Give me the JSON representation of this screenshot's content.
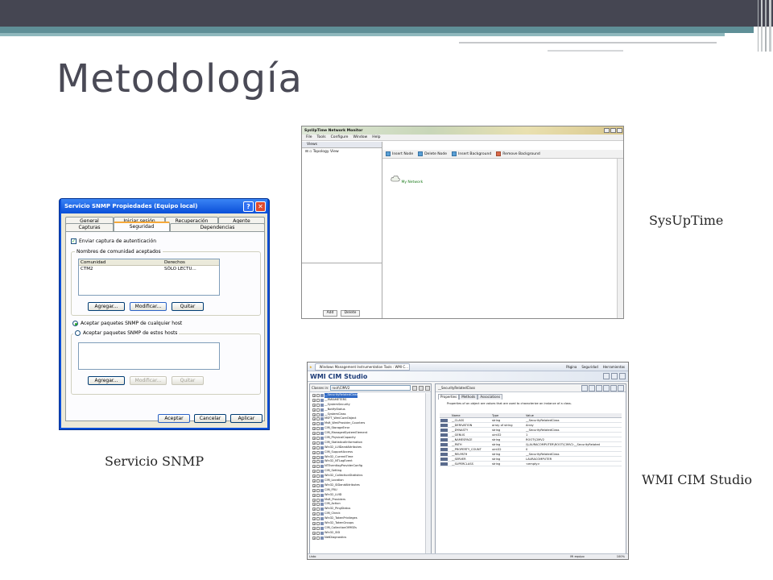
{
  "slide": {
    "title": "Metodología",
    "captions": {
      "sysuptime": "SysUpTime",
      "snmp": "Servicio SNMP",
      "wmi": "WMI CIM Studio"
    }
  },
  "snmp_dialog": {
    "title": "Servicio SNMP Propiedades (Equipo local)",
    "help_glyph": "?",
    "close_glyph": "✕",
    "tabs_row1": [
      "General",
      "Iniciar sesión",
      "Recuperación",
      "Agente"
    ],
    "tabs_row2": [
      "Capturas",
      "Seguridad",
      "Dependencias"
    ],
    "active_tab": "Seguridad",
    "send_auth_trap": "Enviar captura de autenticación",
    "communities_group": "Nombres de comunidad aceptados",
    "list_headers": [
      "Comunidad",
      "Derechos"
    ],
    "list_rows": [
      [
        "CTM2",
        "SÓLO LECTU..."
      ]
    ],
    "community_buttons": [
      "Agregar...",
      "Modificar...",
      "Quitar"
    ],
    "radio_any_host": "Aceptar paquetes SNMP de cualquier host",
    "radio_these_hosts": "Aceptar paquetes SNMP de estos hosts",
    "host_buttons": [
      "Agregar...",
      "Modificar...",
      "Quitar"
    ],
    "footer_buttons": [
      "Aceptar",
      "Cancelar",
      "Aplicar"
    ]
  },
  "sysuptime": {
    "title": "SysUpTime Network Monitor",
    "menu": [
      "File",
      "Tools",
      "Configure",
      "Window",
      "Help"
    ],
    "views_tab": "Views",
    "tree_item": "Topology View",
    "toolbar": [
      "Insert Node",
      "Delete Node",
      "Insert Background",
      "Remove Background"
    ],
    "node_label": "My Network",
    "left_buttons": [
      "Add",
      "Delete"
    ]
  },
  "wmi": {
    "ie_tab": "Windows Management Instrumentation Tools : WMI C...",
    "ie_tools": [
      "Página",
      "Seguridad",
      "Herramientas"
    ],
    "brand": "WMI CIM Studio",
    "classes_label": "Classes in:",
    "namespace": "root\\CIMV2",
    "selected_class": "__SecurityRelatedClass",
    "tabs": [
      "Properties",
      "Methods",
      "Associations"
    ],
    "description": "Properties of an object are values that are used to characterize an instance of a class.",
    "grid_headers": [
      "Name",
      "Type",
      "Value"
    ],
    "properties": [
      [
        "__CLASS",
        "string",
        "__SecurityRelatedClass"
      ],
      [
        "__DERIVATION",
        "array of string",
        "Array"
      ],
      [
        "__DYNASTY",
        "string",
        "__SecurityRelatedClass"
      ],
      [
        "__GENUS",
        "uint32",
        "1"
      ],
      [
        "__NAMESPACE",
        "string",
        "ROOT\\CIMV2"
      ],
      [
        "__PATH",
        "string",
        "\\\\LAURACOMPUTER\\ROOT\\CIMV2:__SecurityRelated"
      ],
      [
        "__PROPERTY_COUNT",
        "uint32",
        "0"
      ],
      [
        "__RELPATH",
        "string",
        "__SecurityRelatedClass"
      ],
      [
        "__SERVER",
        "string",
        "LAURACOMPUTER"
      ],
      [
        "__SUPERCLASS",
        "string",
        "<empty>"
      ]
    ],
    "tree": [
      "__SecurityRelatedClass",
      "__PARAMETERS",
      "__SystemSecurity",
      "__NotifyStatus",
      "__SystemClass",
      "MSFT_WmiCoreObject",
      "Msft_WmiProvider_Counters",
      "CIM_StorageError",
      "CIM_ManagedSystemElement",
      "CIM_PhysicalCapacity",
      "CIM_StatisticalInformation",
      "Win32_LUIDandAttributes",
      "CIM_SupportAccess",
      "Win32_CurrentTime",
      "Win32_NTLogEvent",
      "NTEventlogProviderConfig",
      "CIM_Setting",
      "Win32_CollectionStatistics",
      "CIM_Location",
      "Win32_SIDandAttributes",
      "CIM_FRU",
      "Win32_LUID",
      "Msft_Providers",
      "CIM_Action",
      "Win32_PingStatus",
      "CIM_Check",
      "Win32_TokenPrivileges",
      "Win32_TokenGroups",
      "CIM_CollectionOfMSEs",
      "Win32_SID",
      "NetDiagnostics"
    ],
    "status_left": "Listo",
    "status_zone": "Mi equipo",
    "status_zoom": "100%"
  },
  "colors": {
    "xp_blue": "#0a4fd8",
    "xp_face": "#ece9d8",
    "header_dark": "#454652",
    "header_teal": "#5f8f97"
  }
}
